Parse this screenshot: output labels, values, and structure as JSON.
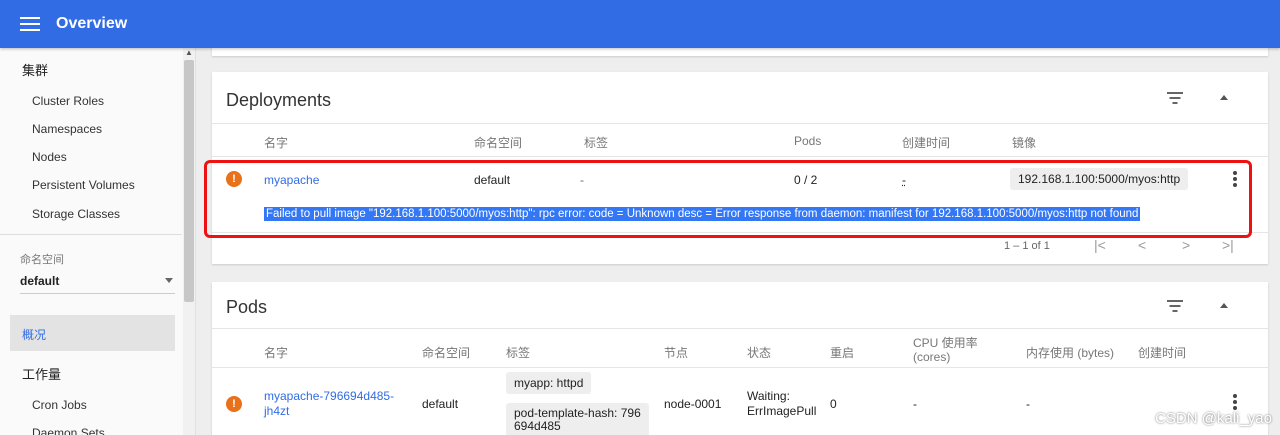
{
  "topbar": {
    "title": "Overview",
    "menu_icon": "menu-icon"
  },
  "sidebar": {
    "section_cluster": "集群",
    "cluster_items": [
      "Cluster Roles",
      "Namespaces",
      "Nodes",
      "Persistent Volumes",
      "Storage Classes"
    ],
    "namespace_label": "命名空间",
    "namespace_value": "default",
    "overview_item": "概况",
    "section_workloads": "工作量",
    "workload_items": [
      "Cron Jobs",
      "Daemon Sets"
    ]
  },
  "deployments": {
    "title": "Deployments",
    "headers": {
      "name": "名字",
      "namespace": "命名空间",
      "labels": "标签",
      "pods": "Pods",
      "created": "创建时间",
      "images": "镜像"
    },
    "rows": [
      {
        "status_icon": "error-icon",
        "name": "myapache",
        "namespace": "default",
        "labels": "-",
        "pods": "0 / 2",
        "created": "-",
        "image": "192.168.1.100:5000/myos:http",
        "error": "Failed to pull image \"192.168.1.100:5000/myos:http\": rpc error: code = Unknown desc = Error response from daemon: manifest for 192.168.1.100:5000/myos:http not found"
      }
    ],
    "pagination": {
      "range": "1 – 1 of 1"
    }
  },
  "pods": {
    "title": "Pods",
    "headers": {
      "name": "名字",
      "namespace": "命名空间",
      "labels": "标签",
      "node": "节点",
      "status": "状态",
      "restarts": "重启",
      "cpu": "CPU 使用率\n(cores)",
      "memory": "内存使用 (bytes)",
      "created": "创建时间"
    },
    "rows": [
      {
        "status_icon": "error-icon",
        "name_line1": "myapache-796694d485-",
        "name_line2": "jh4zt",
        "namespace": "default",
        "label1": "myapp: httpd",
        "label2_line1": "pod-template-hash: 796",
        "label2_line2": "694d485",
        "node": "node-0001",
        "status_line1": "Waiting:",
        "status_line2": "ErrImagePull",
        "restarts": "0",
        "cpu": "-",
        "memory": "-"
      }
    ]
  },
  "watermark": "CSDN @kali_yao",
  "colors": {
    "primary": "#326ce5",
    "error": "#e8711a",
    "highlight": "#ee1111",
    "selection": "#3477f5"
  }
}
